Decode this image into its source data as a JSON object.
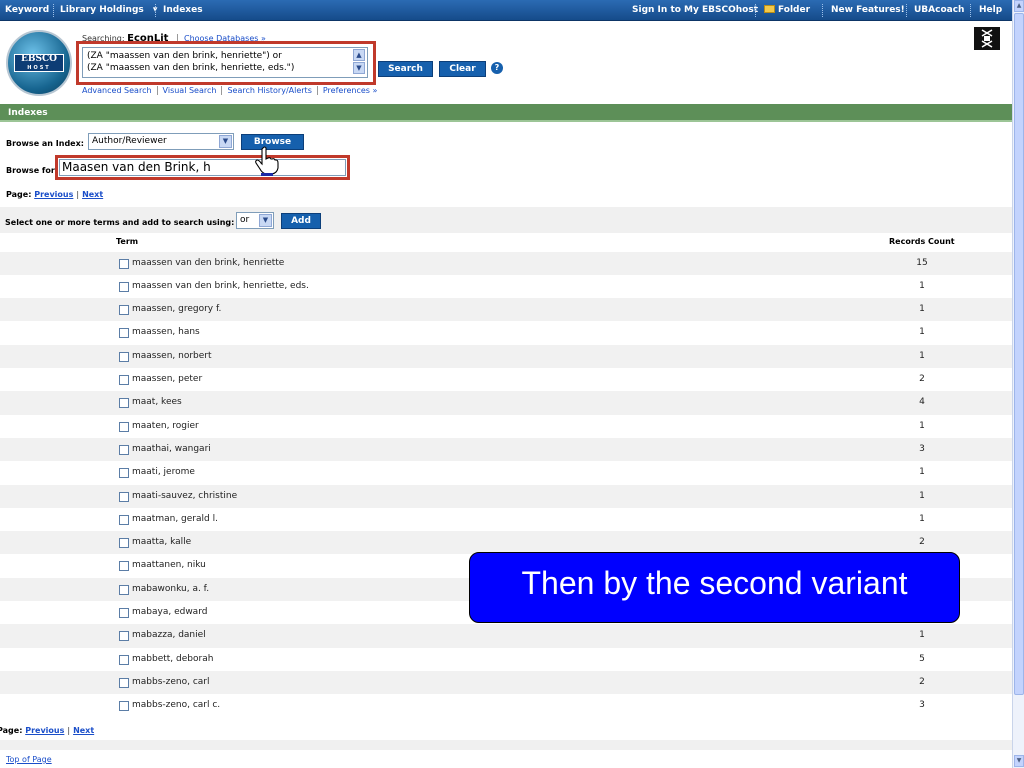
{
  "nav": {
    "keyword": "Keyword",
    "library_holdings": "Library Holdings",
    "dropdown_arrow": "▾",
    "indexes": "Indexes",
    "sign_in": "Sign In to My EBSCOhost",
    "folder": "Folder",
    "new_features": "New Features!",
    "uba_coach": "UBAcoach",
    "help": "Help"
  },
  "header": {
    "logo_text": "EBSCO",
    "logo_sub": "HOST",
    "searching_label": "Searching:",
    "database": "EconLit",
    "choose_databases": "Choose Databases »",
    "query_line1": "(ZA \"maassen van den brink, henriette\") or",
    "query_line2": "(ZA \"maassen van den brink, henriette, eds.\")",
    "search_button": "Search",
    "clear_button": "Clear",
    "help_glyph": "?",
    "links": [
      "Advanced Search",
      "Visual Search",
      "Search History/Alerts",
      "Preferences »"
    ]
  },
  "indexes_bar": "Indexes",
  "browse": {
    "index_label": "Browse an Index:",
    "index_value": "Author/Reviewer",
    "browse_button": "Browse",
    "browse_for_label": "Browse for:",
    "browse_for_value": "Maasen van den Brink, h"
  },
  "paging": {
    "label": "Page:",
    "previous": "Previous",
    "separator": "|",
    "next": "Next"
  },
  "select_terms": {
    "label": "Select one or more terms and add to search using:",
    "operator": "or",
    "add_button": "Add"
  },
  "table": {
    "col_term": "Term",
    "col_count": "Records Count",
    "rows": [
      {
        "term": "maassen van den brink, henriette",
        "count": "15"
      },
      {
        "term": "maassen van den brink, henriette, eds.",
        "count": "1"
      },
      {
        "term": "maassen, gregory f.",
        "count": "1"
      },
      {
        "term": "maassen, hans",
        "count": "1"
      },
      {
        "term": "maassen, norbert",
        "count": "1"
      },
      {
        "term": "maassen, peter",
        "count": "2"
      },
      {
        "term": "maat, kees",
        "count": "4"
      },
      {
        "term": "maaten, rogier",
        "count": "1"
      },
      {
        "term": "maathai, wangari",
        "count": "3"
      },
      {
        "term": "maati, jerome",
        "count": "1"
      },
      {
        "term": "maati-sauvez, christine",
        "count": "1"
      },
      {
        "term": "maatman, gerald l.",
        "count": "1"
      },
      {
        "term": "maatta, kalle",
        "count": "2"
      },
      {
        "term": "maattanen, niku",
        "count": ""
      },
      {
        "term": "mabawonku, a. f.",
        "count": ""
      },
      {
        "term": "mabaya, edward",
        "count": ""
      },
      {
        "term": "mabazza, daniel",
        "count": "1"
      },
      {
        "term": "mabbett, deborah",
        "count": "5"
      },
      {
        "term": "mabbs-zeno, carl",
        "count": "2"
      },
      {
        "term": "mabbs-zeno, carl c.",
        "count": "3"
      }
    ]
  },
  "callout": "Then by the second variant",
  "top_of_page": "Top of Page"
}
